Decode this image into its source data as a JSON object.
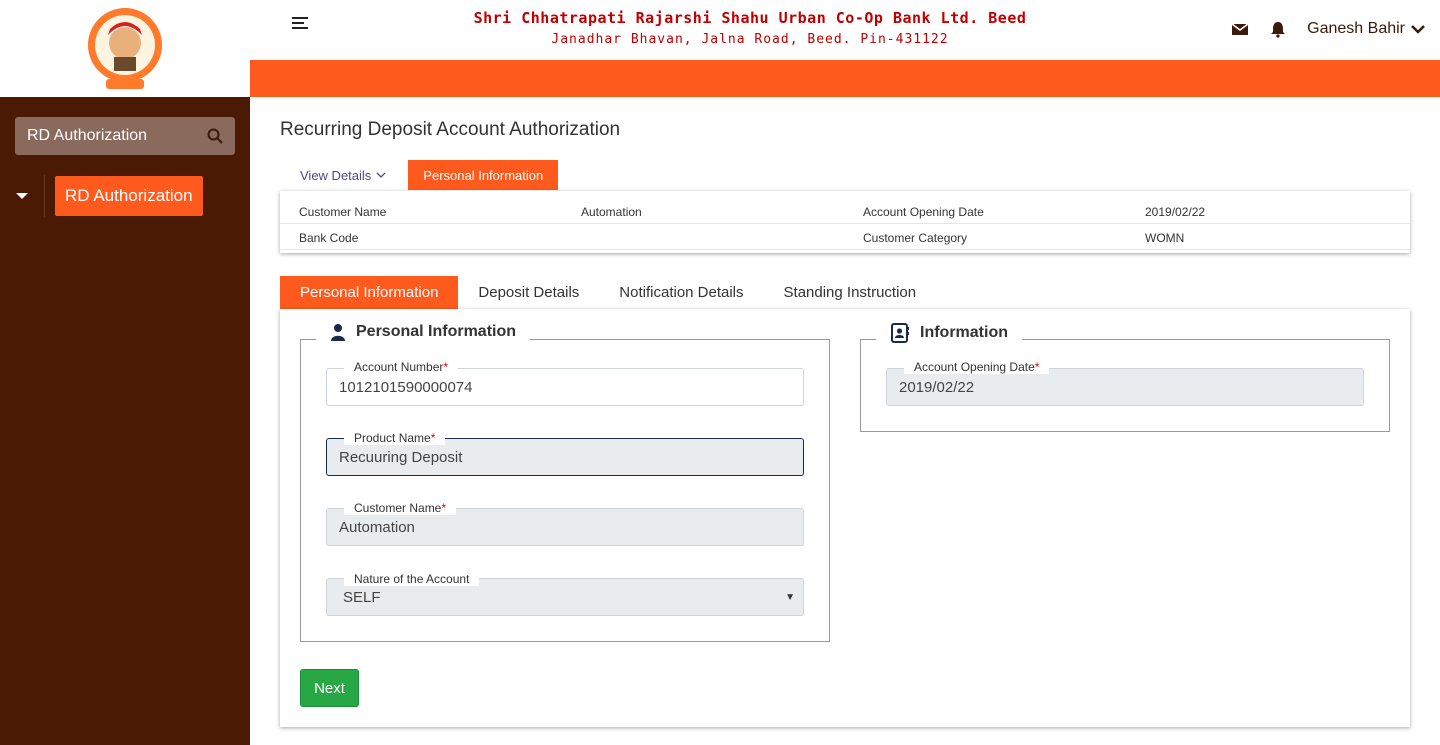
{
  "header": {
    "bank_name": "Shri Chhatrapati Rajarshi Shahu Urban Co-Op Bank Ltd. Beed",
    "bank_address": "Janadhar Bhavan, Jalna Road, Beed. Pin-431122",
    "user_name": "Ganesh Bahir",
    "icons": [
      "menu-icon",
      "mail-icon",
      "bell-icon",
      "chevron-down-icon"
    ],
    "accent_color": "#ff5a1e"
  },
  "sidebar": {
    "search_label": "RD Authorization",
    "active_item": "RD Authorization",
    "bg_color": "#4a1a05"
  },
  "main": {
    "page_title": "Recurring Deposit Account Authorization",
    "top_tabs": {
      "view_details": "View Details",
      "personal_info": "Personal Information"
    },
    "summary": {
      "rows": [
        {
          "l1": "Customer Name",
          "v1": "Automation",
          "l2": "Account Opening Date",
          "v2": "2019/02/22"
        },
        {
          "l1": "Bank Code",
          "v1": "",
          "l2": "Customer Category",
          "v2": "WOMN"
        }
      ]
    },
    "form_tabs": [
      "Personal Information",
      "Deposit Details",
      "Notification Details",
      "Standing Instruction"
    ],
    "personal_section": {
      "title": "Personal Information",
      "account_number_label": "Account Number",
      "account_number": "1012101590000074",
      "product_name_label": "Product Name",
      "product_name": "Recuuring Deposit",
      "customer_name_label": "Customer Name",
      "customer_name": "Automation",
      "nature_label": "Nature of the Account",
      "nature_value": "SELF",
      "required_mark": "*"
    },
    "info_section": {
      "title": "Information",
      "opening_date_label": "Account Opening Date",
      "opening_date": "2019/02/22"
    },
    "next_button": "Next"
  }
}
